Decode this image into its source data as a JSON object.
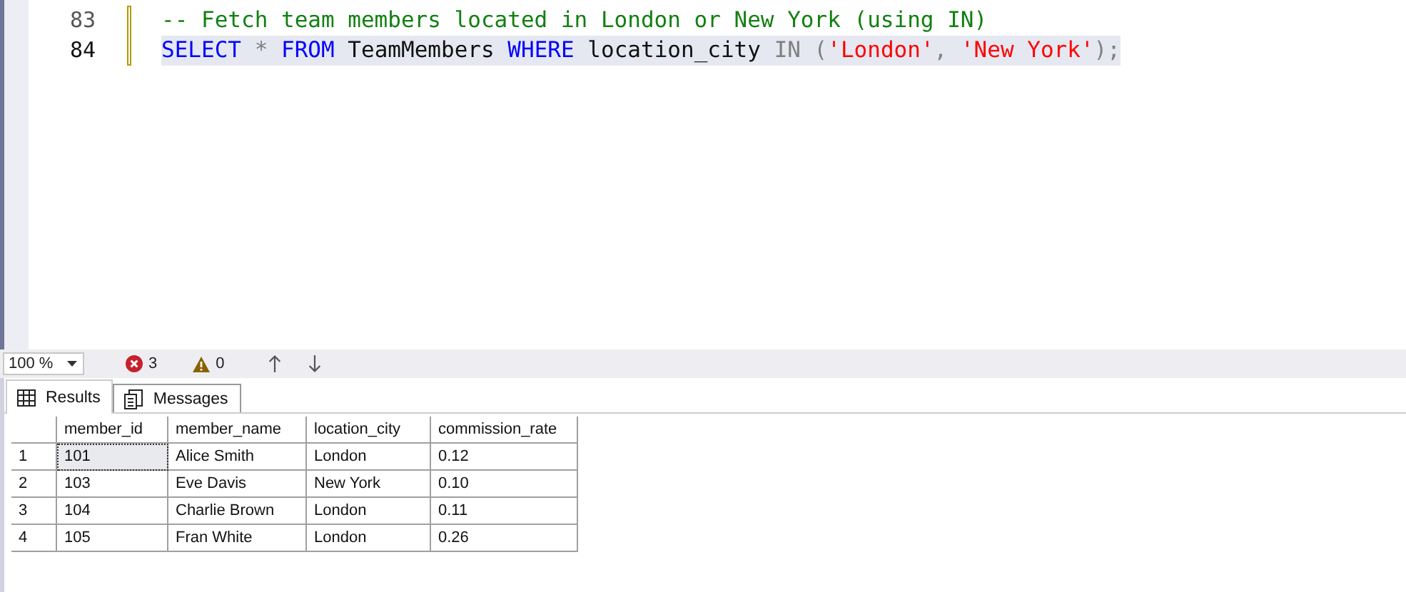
{
  "editor": {
    "lines": [
      {
        "number": "83",
        "highlighted": false,
        "tokens": [
          {
            "text": "-- Fetch team members located in London or New York (using IN)",
            "kind": "comment"
          }
        ]
      },
      {
        "number": "84",
        "highlighted": true,
        "tokens": [
          {
            "text": "SELECT ",
            "kind": "keyword"
          },
          {
            "text": "* ",
            "kind": "operator"
          },
          {
            "text": "FROM",
            "kind": "keyword"
          },
          {
            "text": " TeamMembers ",
            "kind": "plain"
          },
          {
            "text": "WHERE",
            "kind": "keyword"
          },
          {
            "text": " location_city ",
            "kind": "plain"
          },
          {
            "text": "IN (",
            "kind": "operator"
          },
          {
            "text": "'London'",
            "kind": "string"
          },
          {
            "text": ", ",
            "kind": "operator"
          },
          {
            "text": "'New York'",
            "kind": "string"
          },
          {
            "text": ");",
            "kind": "operator"
          }
        ]
      }
    ]
  },
  "status_strip": {
    "zoom": "100 %",
    "errors": "3",
    "warnings": "0"
  },
  "tabs": [
    {
      "label": "Results",
      "selected": true
    },
    {
      "label": "Messages",
      "selected": false
    }
  ],
  "table": {
    "columns": [
      "member_id",
      "member_name",
      "location_city",
      "commission_rate"
    ],
    "rows": [
      {
        "number": "1",
        "selected": true,
        "cells": [
          "101",
          "Alice Smith",
          "London",
          "0.12"
        ]
      },
      {
        "number": "2",
        "selected": false,
        "cells": [
          "103",
          "Eve Davis",
          "New York",
          "0.10"
        ]
      },
      {
        "number": "3",
        "selected": false,
        "cells": [
          "104",
          "Charlie Brown",
          "London",
          "0.11"
        ]
      },
      {
        "number": "4",
        "selected": false,
        "cells": [
          "105",
          "Fran White",
          "London",
          "0.26"
        ]
      }
    ]
  }
}
